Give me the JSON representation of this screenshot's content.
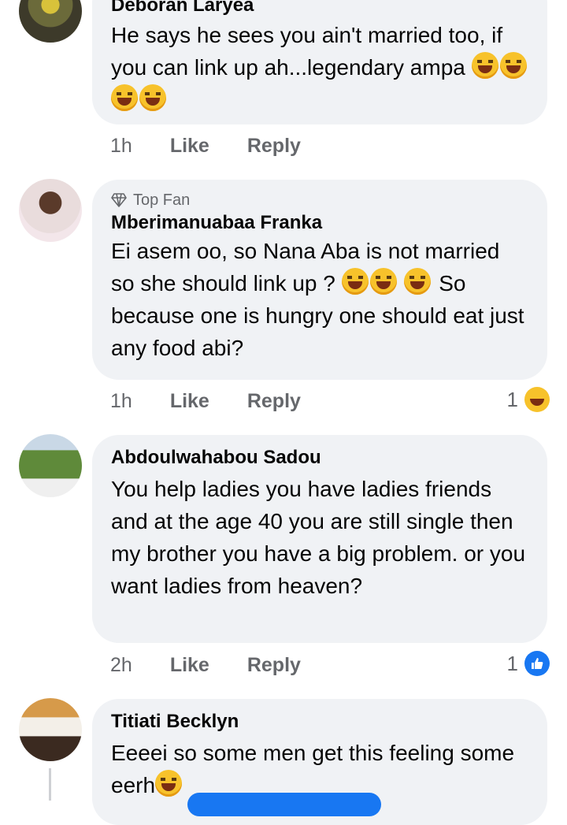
{
  "comments": [
    {
      "name": "Deboran Laryea",
      "text": "He says he sees you ain't married too, if you can link up ah...legendary ampa",
      "time": "1h",
      "like": "Like",
      "reply": "Reply"
    },
    {
      "badge": "Top Fan",
      "name": "Mberimanuabaa Franka",
      "text1": "Ei asem oo, so Nana Aba is not married so she should link up ?",
      "text2": "So because one is hungry one should eat just any food abi?",
      "time": "1h",
      "like": "Like",
      "reply": "Reply",
      "reaction_count": "1"
    },
    {
      "name": "Abdoulwahabou Sadou",
      "text": "You help ladies you have ladies friends and at the age 40 you are still single then my brother you have a big problem. or you want ladies from heaven?",
      "time": "2h",
      "like": "Like",
      "reply": "Reply",
      "reaction_count": "1"
    },
    {
      "name": "Titiati Becklyn",
      "text": "Eeeei so some men get this feeling some eerh"
    }
  ],
  "icons": {
    "emoji": "rolling-on-floor-laughing",
    "badge": "diamond-icon",
    "reaction_laugh": "haha-reaction",
    "reaction_like": "like-reaction"
  },
  "colors": {
    "bubble": "#f0f2f5",
    "meta": "#65676b",
    "like_blue": "#1877f2"
  }
}
